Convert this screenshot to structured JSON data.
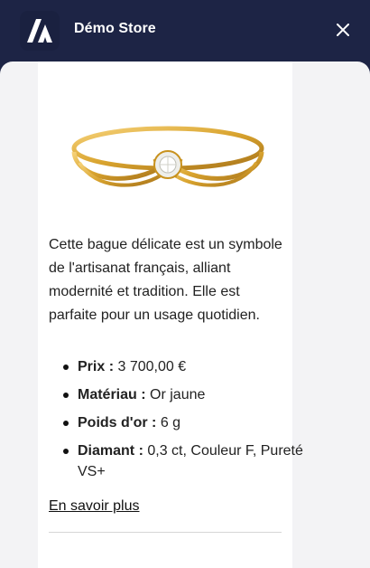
{
  "header": {
    "store_name": "Démo Store",
    "logo_icon": "store-logo-icon",
    "close_icon": "close-icon"
  },
  "product": {
    "image_icon": "gold-solitaire-ring-image",
    "description": "Cette bague délicate est un symbole de l'artisanat français, alliant modernité et tradition. Elle est parfaite pour un usage quotidien.",
    "specs": [
      {
        "label": "Prix :",
        "value": "3 700,00 €"
      },
      {
        "label": "Matériau :",
        "value": "Or jaune"
      },
      {
        "label": "Poids d'or :",
        "value": "6 g"
      },
      {
        "label": "Diamant :",
        "value": "0,3 ct, Couleur F, Pureté VS+"
      }
    ],
    "learn_more": "En savoir plus"
  },
  "colors": {
    "header_bg": "#1d2445",
    "sheet_bg": "#f3f3f5",
    "card_bg": "#ffffff",
    "gold": "#d9a42f"
  }
}
